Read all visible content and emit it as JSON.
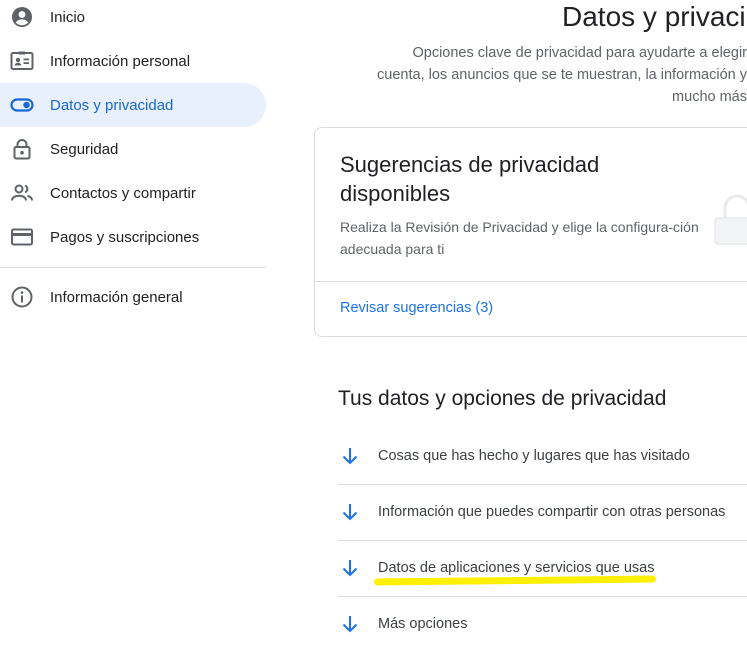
{
  "sidebar": {
    "items": [
      {
        "label": "Inicio",
        "icon": "account-circle-icon"
      },
      {
        "label": "Información personal",
        "icon": "id-card-icon"
      },
      {
        "label": "Datos y privacidad",
        "icon": "toggle-icon"
      },
      {
        "label": "Seguridad",
        "icon": "lock-icon"
      },
      {
        "label": "Contactos y compartir",
        "icon": "people-icon"
      },
      {
        "label": "Pagos y suscripciones",
        "icon": "credit-card-icon"
      },
      {
        "label": "Información general",
        "icon": "info-icon"
      }
    ]
  },
  "main": {
    "title": "Datos y privaci",
    "subtitle": "Opciones clave de privacidad para ayudarte a elegir cuenta, los anuncios que se te muestran, la información y mucho más",
    "suggestions_card": {
      "title": "Sugerencias de privacidad disponibles",
      "description": "Realiza la Revisión de Privacidad y elige la configura-ción adecuada para ti",
      "link": "Revisar sugerencias (3)"
    },
    "section_title": "Tus datos y opciones de privacidad",
    "rows": [
      {
        "label": "Cosas que has hecho y lugares que has visitado"
      },
      {
        "label": "Información que puedes compartir con otras personas"
      },
      {
        "label": "Datos de aplicaciones y servicios que usas",
        "highlighted": true
      },
      {
        "label": "Más opciones"
      }
    ]
  },
  "colors": {
    "accent": "#1a73e8",
    "active_bg": "#e8f0fe",
    "active_text": "#1967d2",
    "highlight": "#ffef00"
  }
}
